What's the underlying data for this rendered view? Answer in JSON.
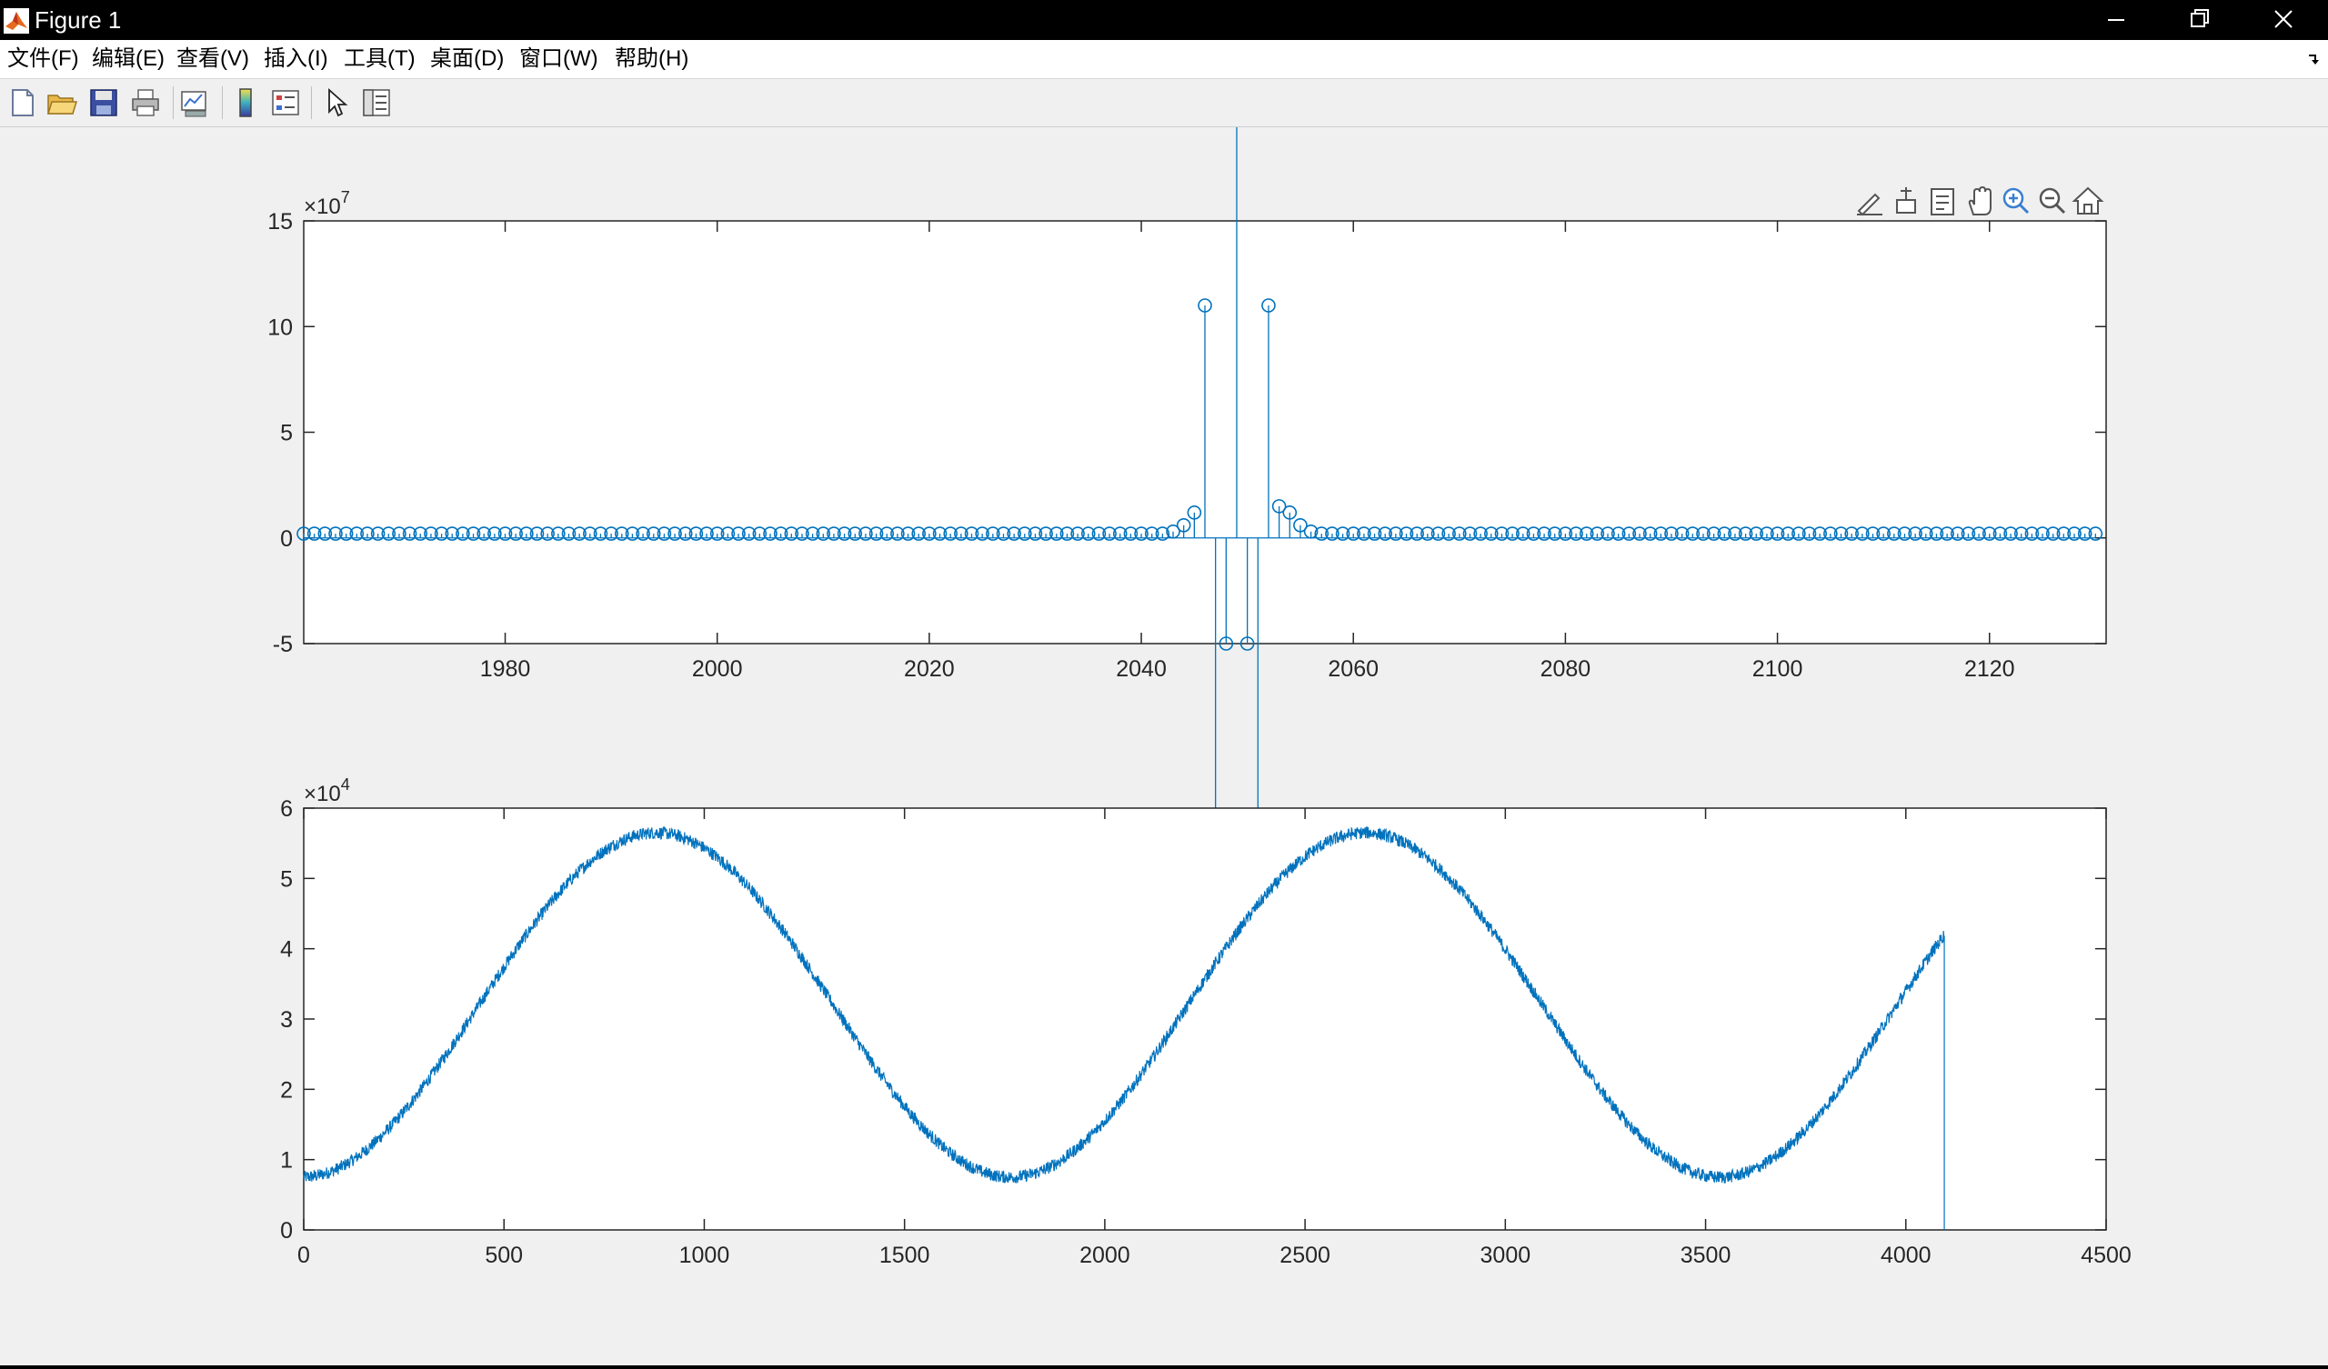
{
  "window": {
    "title": "Figure 1"
  },
  "menu": [
    {
      "label": "文件(F)"
    },
    {
      "label": "编辑(E)"
    },
    {
      "label": "查看(V)"
    },
    {
      "label": "插入(I)"
    },
    {
      "label": "工具(T)"
    },
    {
      "label": "桌面(D)"
    },
    {
      "label": "窗口(W)"
    },
    {
      "label": "帮助(H)"
    }
  ],
  "toolbar": {
    "icons": [
      "new-figure-icon",
      "open-file-icon",
      "save-icon",
      "print-icon",
      "link-plot-icon",
      "colorbar-icon",
      "legend-icon",
      "edit-plot-icon",
      "property-inspector-icon"
    ]
  },
  "axes_toolbar": {
    "icons": [
      "brush-icon",
      "data-tips-icon",
      "export-icon",
      "pan-icon",
      "zoom-in-icon",
      "zoom-out-icon",
      "home-icon"
    ]
  },
  "colors": {
    "series": "#0072bd",
    "background": "#f0f0f0",
    "axes": "#ffffff"
  },
  "chart_data": [
    {
      "type": "stem",
      "exponent_label": "×10",
      "exponent_power": "7",
      "scale": 10000000,
      "xlim": [
        1961,
        2131
      ],
      "ylim": [
        -5,
        15
      ],
      "xticks": [
        1980,
        2000,
        2020,
        2040,
        2060,
        2080,
        2100,
        2120
      ],
      "yticks": [
        -5,
        0,
        5,
        10,
        15
      ],
      "grid": false,
      "x_start": 1961,
      "x_end": 2130,
      "baseline_value": 2000000,
      "values": [
        [
          2043,
          3000000
        ],
        [
          2044,
          6000000
        ],
        [
          2045,
          12000000
        ],
        [
          2046,
          110000000
        ],
        [
          2047,
          -220000000
        ],
        [
          2048,
          -50000000
        ],
        [
          2049,
          1250000000
        ],
        [
          2050,
          -50000000
        ],
        [
          2051,
          -220000000
        ],
        [
          2052,
          110000000
        ],
        [
          2053,
          15000000
        ],
        [
          2054,
          12000000
        ],
        [
          2055,
          6000000
        ],
        [
          2056,
          3000000
        ]
      ]
    },
    {
      "type": "line",
      "exponent_label": "×10",
      "exponent_power": "4",
      "scale": 10000,
      "xlim": [
        0,
        4500
      ],
      "ylim": [
        0,
        6
      ],
      "xticks": [
        0,
        500,
        1000,
        1500,
        2000,
        2500,
        3000,
        3500,
        4000,
        4500
      ],
      "yticks": [
        0,
        1,
        2,
        3,
        4,
        5,
        6
      ],
      "grid": false,
      "n_points": 4097,
      "signal": {
        "shape": "sinusoid with noise",
        "mean": 32000,
        "amplitude": 24500,
        "period": 1770,
        "peak_at": 880,
        "noise_amplitude": 900
      },
      "x_end": 4096,
      "final_drop_value": 0
    }
  ]
}
